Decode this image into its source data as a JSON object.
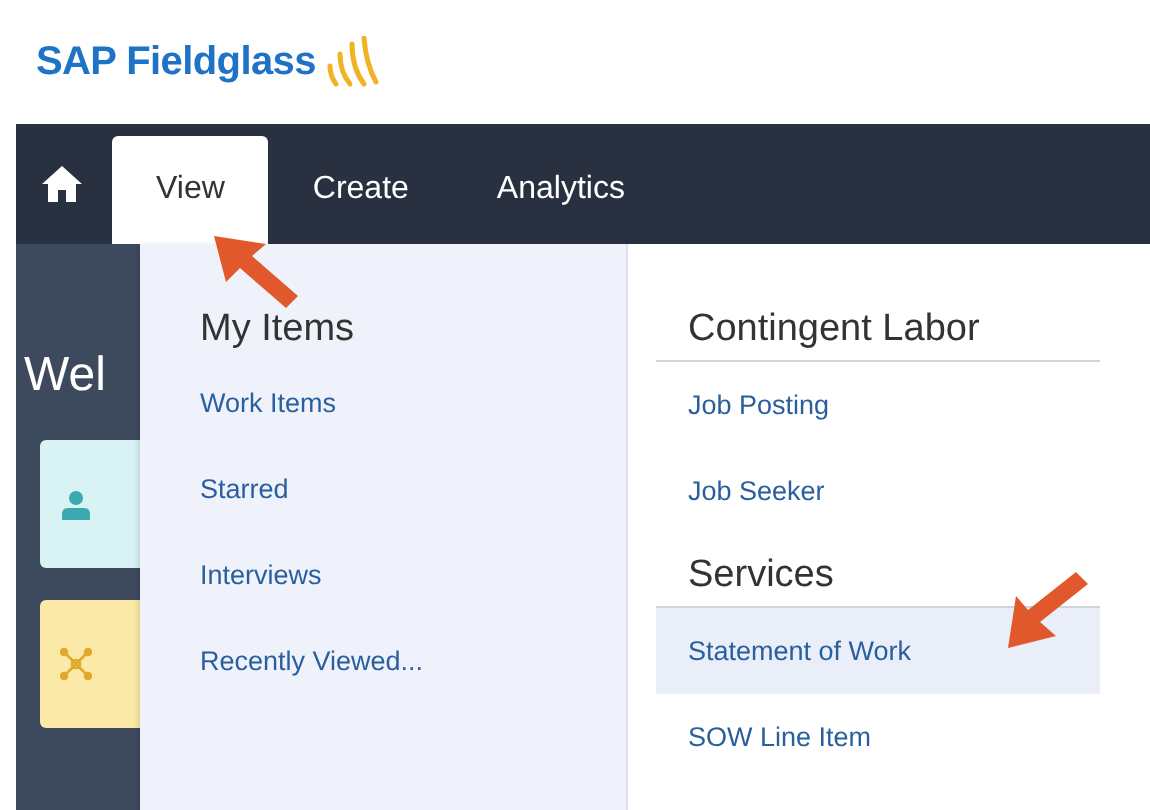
{
  "header": {
    "logo_text": "SAP Fieldglass"
  },
  "nav": {
    "tabs": [
      {
        "label": "View",
        "selected": true
      },
      {
        "label": "Create",
        "selected": false
      },
      {
        "label": "Analytics",
        "selected": false
      }
    ]
  },
  "page": {
    "welcome": "Wel",
    "tiles": [
      {
        "kind": "person"
      },
      {
        "kind": "network"
      }
    ]
  },
  "menu": {
    "columns": [
      {
        "sections": [
          {
            "heading": "My Items",
            "items": [
              {
                "label": "Work Items",
                "selected": false
              },
              {
                "label": "Starred",
                "selected": false
              },
              {
                "label": "Interviews",
                "selected": false
              },
              {
                "label": "Recently Viewed...",
                "selected": false
              }
            ]
          }
        ]
      },
      {
        "sections": [
          {
            "heading": "Contingent Labor",
            "items": [
              {
                "label": "Job Posting",
                "selected": false
              },
              {
                "label": "Job Seeker",
                "selected": false
              }
            ]
          },
          {
            "heading": "Services",
            "items": [
              {
                "label": "Statement of Work",
                "selected": true
              },
              {
                "label": "SOW Line Item",
                "selected": false
              }
            ]
          }
        ]
      }
    ]
  }
}
